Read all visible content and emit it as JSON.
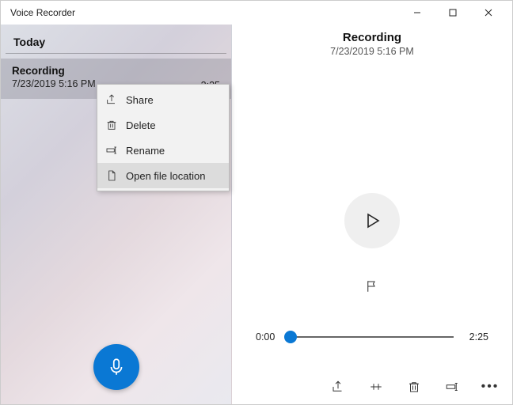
{
  "window": {
    "title": "Voice Recorder"
  },
  "left": {
    "section": "Today",
    "item": {
      "title": "Recording",
      "datetime": "7/23/2019 5:16 PM",
      "duration": "2:25"
    }
  },
  "context_menu": {
    "share": "Share",
    "delete": "Delete",
    "rename": "Rename",
    "open_location": "Open file location"
  },
  "right": {
    "title": "Recording",
    "datetime": "7/23/2019 5:16 PM",
    "time_start": "0:00",
    "time_end": "2:25"
  }
}
